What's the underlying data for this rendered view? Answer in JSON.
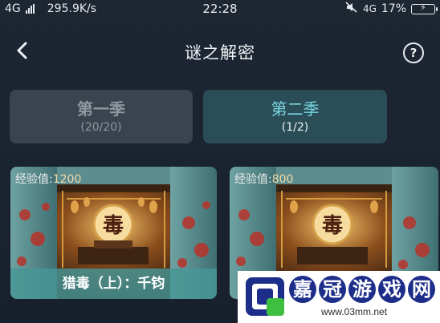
{
  "status_bar": {
    "network_left": "4G",
    "speed": "295.9K/s",
    "time": "22:28",
    "network_right": "4G",
    "battery": "17%"
  },
  "header": {
    "title": "谜之解密",
    "help": "?"
  },
  "tabs": [
    {
      "name": "第一季",
      "count": "(20/20)"
    },
    {
      "name": "第二季",
      "count": "(1/2)"
    }
  ],
  "cards": [
    {
      "exp_label": "经验值:",
      "exp_value": "1200",
      "caption": "猎毒（上）：千钧",
      "sign": "毒"
    },
    {
      "exp_label": "经验值:",
      "exp_value": "800",
      "caption": "",
      "sign": "毒"
    }
  ],
  "watermark": {
    "chars": [
      "嘉",
      "冠",
      "游",
      "戏",
      "网"
    ],
    "url": "www.03mm.net"
  },
  "colors": {
    "background": "#1b2430",
    "tab_selected": "#2a4d58",
    "tab_selected_text": "#7ad6df",
    "caption_bar": "#489696",
    "watermark_blue": "#1d2e8a"
  }
}
